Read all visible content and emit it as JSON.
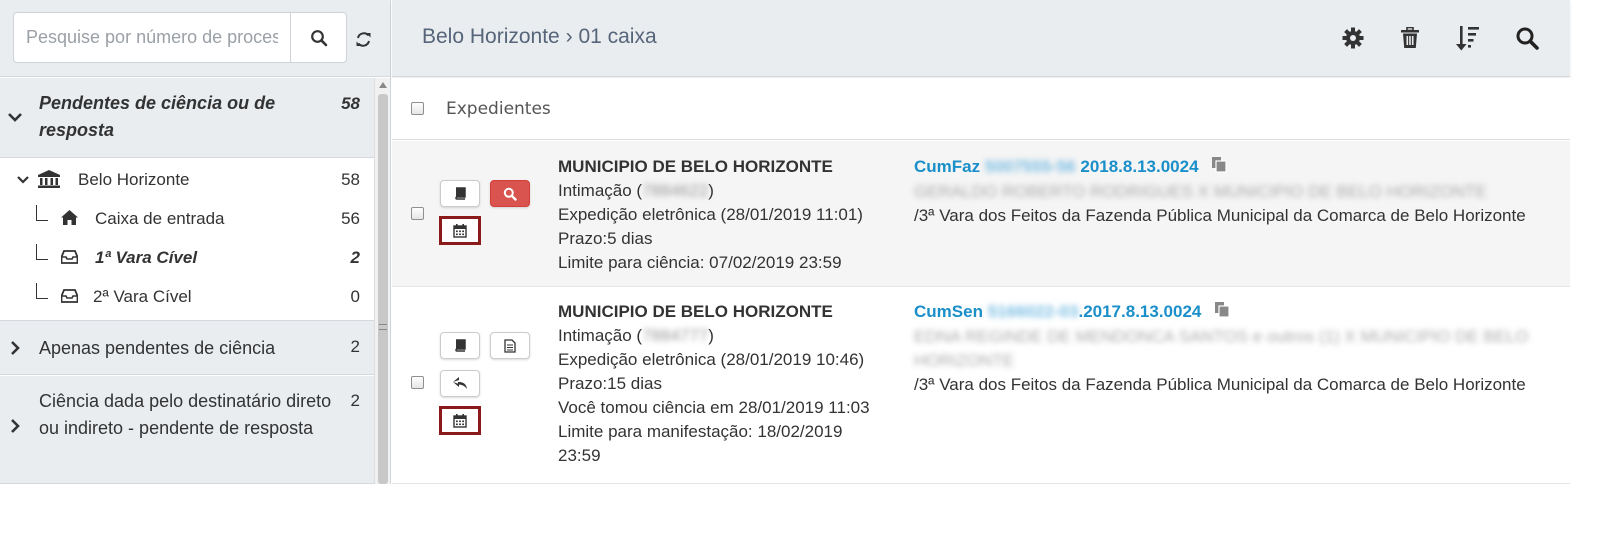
{
  "search": {
    "placeholder": "Pesquise por número de processo"
  },
  "sidebar": {
    "groups": [
      {
        "title": "Pendentes de ciência ou de resposta",
        "count": "58"
      },
      {
        "title": "Apenas pendentes de ciência",
        "count": "2"
      },
      {
        "title": "Ciência dada pelo destinatário direto ou indireto - pendente de resposta",
        "count": "2"
      }
    ],
    "nodes": [
      {
        "label": "Belo Horizonte",
        "count": "58",
        "icon": "bank-icon"
      },
      {
        "label": "Caixa de entrada",
        "count": "56",
        "icon": "home-icon"
      },
      {
        "label": "1ª Vara Cível",
        "count": "2",
        "icon": "inbox-icon"
      },
      {
        "label": "2ª Vara Cível",
        "count": "0",
        "icon": "inbox-icon"
      }
    ]
  },
  "header": {
    "breadcrumb_root": "Belo Horizonte",
    "breadcrumb_sep": "›",
    "breadcrumb_leaf": "01 caixa"
  },
  "list": {
    "title": "Expedientes",
    "rows": [
      {
        "owner": "MUNICIPIO DE BELO HORIZONTE",
        "intimacao_prefix": "Intimação (",
        "intimacao_id": "7884622",
        "intimacao_suffix": ")",
        "expedicao": "Expedição eletrônica (28/01/2019 11:01)",
        "prazo": "Prazo:5 dias",
        "limite": "Limite para ciência: 07/02/2019 23:59",
        "class": "CumFaz",
        "num_hidden": "5007555-56",
        "num_visible": "2018.8.13.0024",
        "parties": "GERALDO ROBERTO RODRIGUES X MUNICIPIO DE BELO HORIZONTE",
        "orgao": "/3ª Vara dos Feitos da Fazenda Pública Municipal da Comarca de Belo Horizonte"
      },
      {
        "owner": "MUNICIPIO DE BELO HORIZONTE",
        "intimacao_prefix": "Intimação (",
        "intimacao_id": "7884777",
        "intimacao_suffix": ")",
        "expedicao": "Expedição eletrônica (28/01/2019 10:46)",
        "prazo": "Prazo:15 dias",
        "ciencia": "Você tomou ciência em 28/01/2019 11:03",
        "limite": "Limite para manifestação: 18/02/2019 23:59",
        "class": "CumSen",
        "num_hidden": "5166022-03",
        "num_visible": ".2017.8.13.0024",
        "parties": "EDNA REGINDE DE MENDONCA SANTOS e outros (1) X MUNICIPIO DE BELO HORIZONTE",
        "orgao": "/3ª Vara dos Feitos da Fazenda Pública Municipal da Comarca de Belo Horizonte"
      }
    ]
  },
  "colors": {
    "accent_blue": "#1a8fc9",
    "danger": "#d9534f",
    "highlight_border": "#8b1a1a",
    "panel_bg": "#e9edf0"
  }
}
